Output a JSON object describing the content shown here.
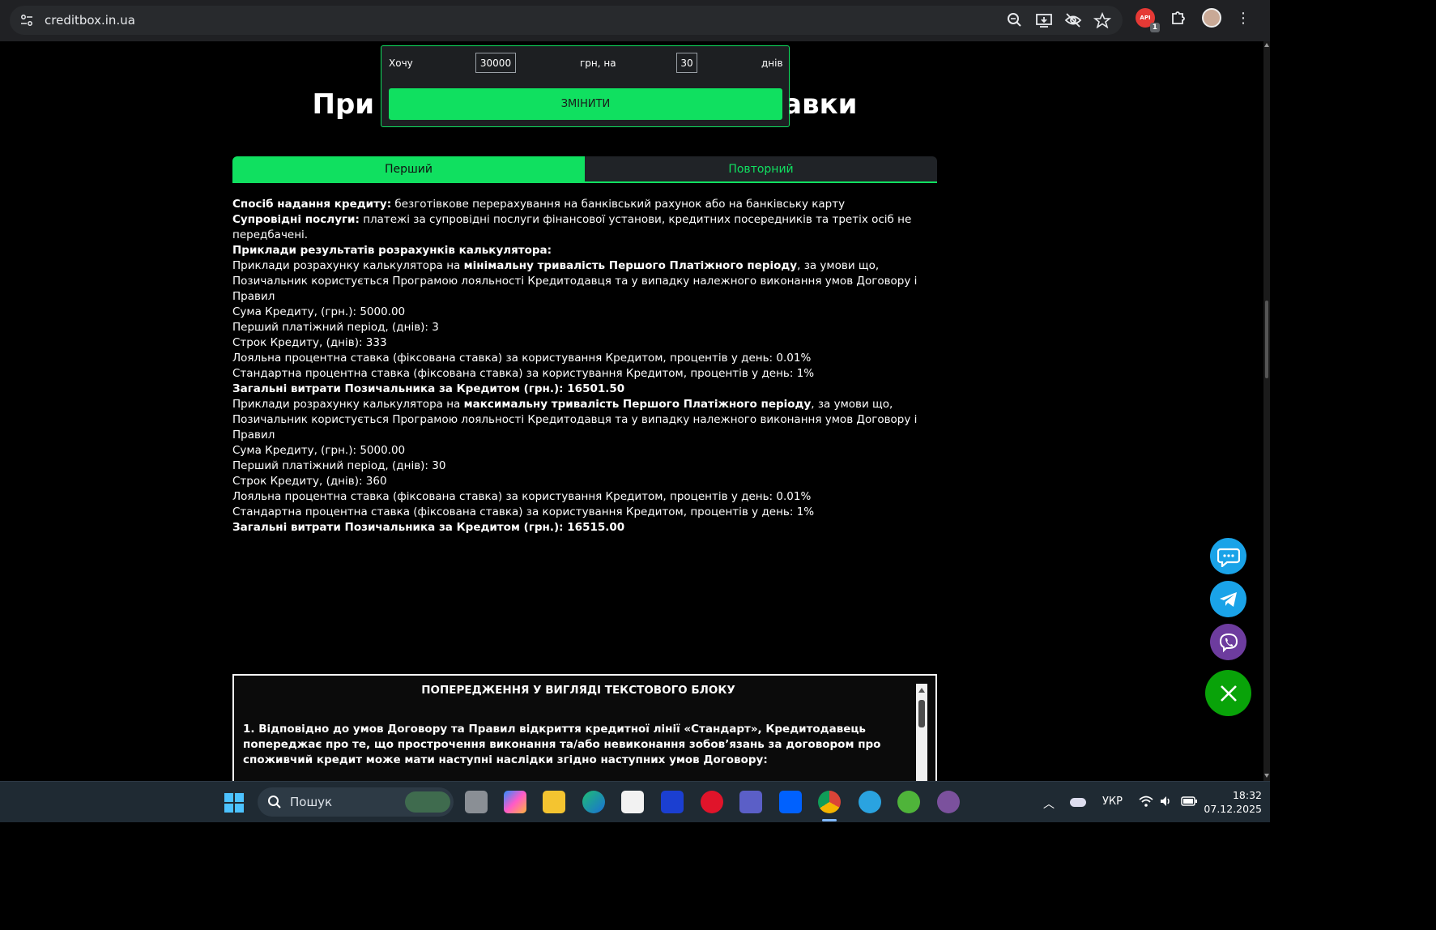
{
  "browser": {
    "url": "creditbox.in.ua",
    "extension_badge_count": "1",
    "extension_badge_label": "АРІ"
  },
  "page": {
    "title_left": "При",
    "title_right": "авки"
  },
  "calculator": {
    "want_label": "Хочу",
    "amount_value": "30000",
    "currency_label": "грн, на",
    "days_value": "30",
    "days_label": "днів",
    "change_button": "ЗМІНИТИ"
  },
  "tabs": [
    {
      "label": "Перший",
      "active": true
    },
    {
      "label": "Повторний",
      "active": false
    }
  ],
  "content": {
    "method_label": "Спосіб надання кредиту:",
    "method_text": " безготівкове перерахування на банківський рахунок або на банківську карту",
    "services_label": "Супровідні послуги:",
    "services_text": " платежі за супровідні послуги фінансової установи, кредитних посередників та третіх осіб не передбачені.",
    "examples_heading": "Приклади результатів розрахунків калькулятора:",
    "example1": {
      "intro_prefix": "Приклади розрахунку калькулятора на ",
      "intro_bold": "мінімальну тривалість Першого Платіжного періоду",
      "intro_suffix": ", за умови що, Позичальник користується Програмою лояльності Кредитодавця та у випадку належного виконання умов Договору і Правил",
      "amount": "Сума Кредиту, (грн.): 5000.00",
      "first_period": "Перший платіжний період, (днів): 3",
      "term": "Строк Кредиту, (днів): 333",
      "loyal_rate": "Лояльна процентна ставка (фіксована ставка) за користування Кредитом, процентів у день: 0.01%",
      "standard_rate": "Стандартна процентна ставка (фіксована ставка) за користування Кредитом, процентів у день: 1%",
      "total": "Загальні витрати Позичальника за Кредитом (грн.): 16501.50"
    },
    "example2": {
      "intro_prefix": "Приклади розрахунку калькулятора на ",
      "intro_bold": "максимальну тривалість Першого Платіжного періоду",
      "intro_suffix": ", за умови що, Позичальник користується Програмою лояльності Кредитодавця та у випадку належного виконання умов Договору і Правил",
      "amount": "Сума Кредиту, (грн.): 5000.00",
      "first_period": "Перший платіжний період, (днів): 30",
      "term": "Строк Кредиту, (днів): 360",
      "loyal_rate": "Лояльна процентна ставка (фіксована ставка) за користування Кредитом, процентів у день: 0.01%",
      "standard_rate": "Стандартна процентна ставка (фіксована ставка) за користування Кредитом, процентів у день: 1%",
      "total": "Загальні витрати Позичальника за Кредитом (грн.): 16515.00"
    }
  },
  "warning": {
    "title": "ПОПЕРЕДЖЕННЯ У ВИГЛЯДІ ТЕКСТОВОГО БЛОКУ",
    "text": "1. Відповідно до умов Договору та Правил відкриття кредитної лінії «Стандарт», Кредитодавець попереджає про те, що прострочення виконання та/або невиконання зобов’язань за договором про споживчий кредит може мати наступні наслідки згідно наступних умов Договору:"
  },
  "taskbar": {
    "search_placeholder": "Пошук",
    "language": "УКР",
    "time": "18:32",
    "date": "07.12.2025"
  },
  "colors": {
    "accent_green": "#10e060",
    "telegram_blue": "#1aa3e8",
    "viber_purple": "#6d3c9e",
    "close_green": "#09a309"
  }
}
